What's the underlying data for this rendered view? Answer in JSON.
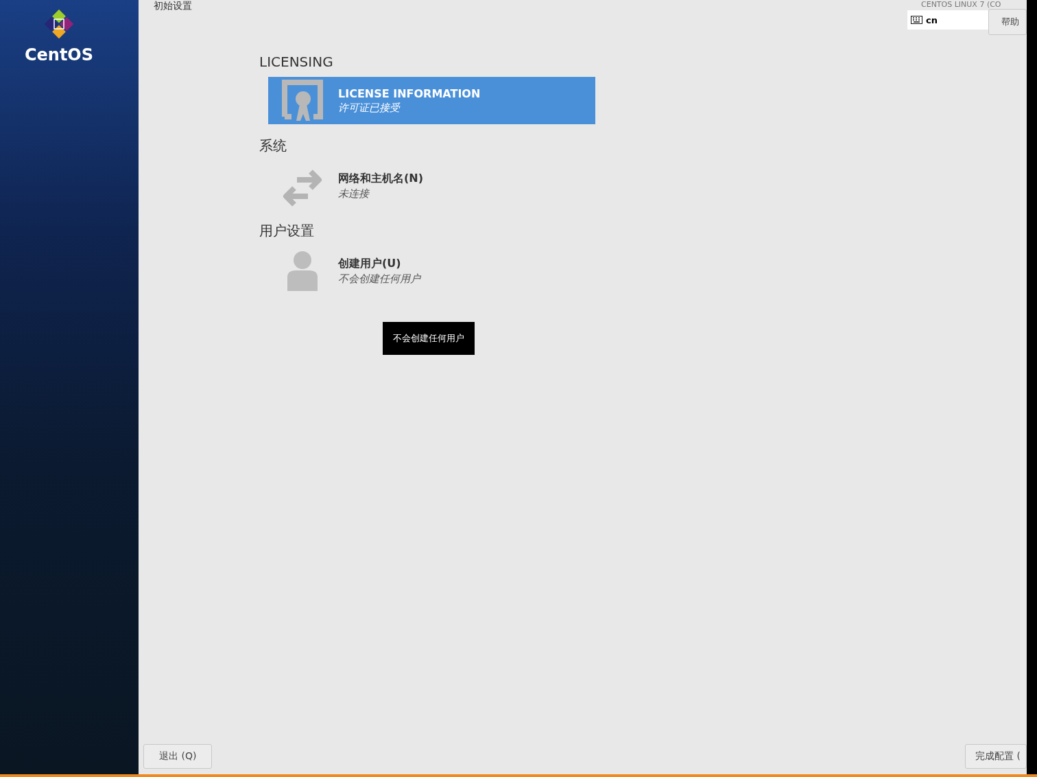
{
  "sidebar": {
    "logo_text": "CentOS"
  },
  "header": {
    "title": "初始设置",
    "product": "CENTOS LINUX 7 (CO",
    "keyboard": "cn",
    "help_button": "帮助"
  },
  "sections": [
    {
      "title": "LICENSING",
      "items": [
        {
          "kind": "license",
          "title": "LICENSE INFORMATION",
          "status": "许可证已接受",
          "selected": true
        }
      ]
    },
    {
      "title": "系统",
      "items": [
        {
          "kind": "network",
          "title": "网络和主机名(N)",
          "status": "未连接",
          "selected": false
        }
      ]
    },
    {
      "title": "用户设置",
      "items": [
        {
          "kind": "user",
          "title": "创建用户(U)",
          "status": "不会创建任何用户",
          "selected": false
        }
      ]
    }
  ],
  "tooltip": "不会创建任何用户",
  "footer": {
    "quit_button": "退出 (Q)",
    "finish_button": "完成配置 ("
  }
}
